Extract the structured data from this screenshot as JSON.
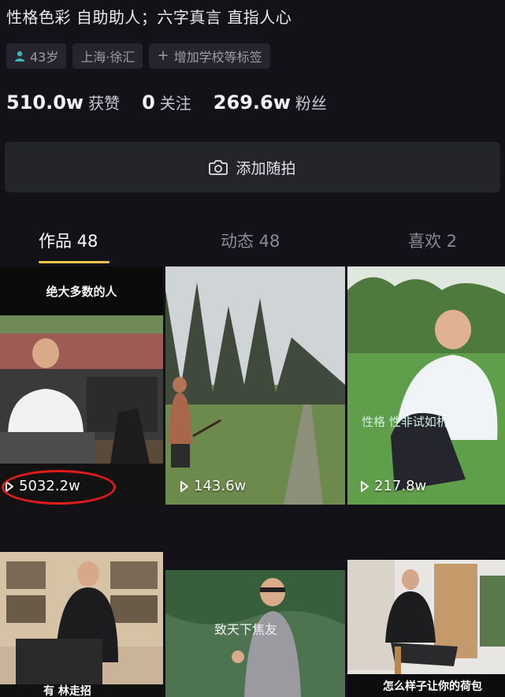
{
  "profile": {
    "bio": "性格色彩 自助助人；六字真言 直指人心",
    "tags": {
      "age": "43岁",
      "location": "上海·徐汇",
      "add_school": "增加学校等标签"
    },
    "stats": [
      {
        "value": "510.0w",
        "label": "获赞"
      },
      {
        "value": "0",
        "label": "关注"
      },
      {
        "value": "269.6w",
        "label": "粉丝"
      }
    ],
    "add_button": "添加随拍"
  },
  "tabs": [
    {
      "label": "作品 48",
      "active": true
    },
    {
      "label": "动态 48",
      "active": false
    },
    {
      "label": "喜欢 2",
      "active": false
    }
  ],
  "videos": [
    {
      "views": "5032.2w",
      "caption": "绝大多数的人"
    },
    {
      "views": "143.6w"
    },
    {
      "views": "217.8w",
      "caption": "性格 性非试如析"
    },
    {
      "caption": "有   林走招"
    },
    {
      "caption": "致天下焦友"
    },
    {
      "caption": "怎么样子让你的荷包"
    }
  ],
  "colors": {
    "background": "#121218",
    "accent_underline": "#f0c24b",
    "highlight_ring": "#e01b1b"
  }
}
